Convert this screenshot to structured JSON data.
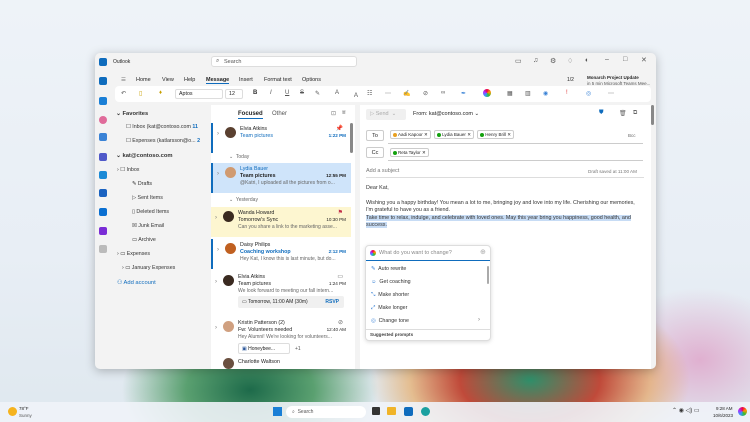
{
  "window": {
    "app_title": "Outlook",
    "search_placeholder": "Search"
  },
  "menu_tabs": [
    "Home",
    "View",
    "Help",
    "Message",
    "Insert",
    "Format text",
    "Options"
  ],
  "active_tab": "Message",
  "ribbon": {
    "font": "Aptos",
    "size": "12",
    "bold": "B",
    "italic": "I",
    "underline": "U",
    "strike": "S"
  },
  "notification": {
    "counter": "1/2",
    "title": "Monarch Project Update",
    "subtitle": "in 5 min Microsoft Teams Mee..."
  },
  "folders": {
    "favorites_label": "Favorites",
    "favorites": [
      {
        "label": "Inbox (kat@contoso.com",
        "count": "11"
      },
      {
        "label": "Expenses (katlarsson@o...",
        "count": "2"
      }
    ],
    "account": "kat@contoso.com",
    "items": [
      "Inbox",
      "Drafts",
      "Sent Items",
      "Deleted Items",
      "Junk Email",
      "Archive",
      "Expenses",
      "January Expenses"
    ],
    "add_account": "Add account"
  },
  "list": {
    "tabs": [
      "Focused",
      "Other"
    ],
    "groups": [
      "Today",
      "Yesterday"
    ],
    "mails": [
      {
        "name": "Elvia Atkins",
        "subject": "Team pictures",
        "preview": "",
        "time": "1:22 PM"
      },
      {
        "name": "Lydia Bauer",
        "subject": "Team pictures",
        "preview": "@Katri, I uploaded all the pictures from o...",
        "time": "12:55 PM"
      },
      {
        "name": "Wanda Howard",
        "subject": "Tomorrow's Sync",
        "preview": "Can you share a link to the marketing asse...",
        "time": "10:30 PM"
      },
      {
        "name": "Daisy Philips",
        "subject": "Coaching workshop",
        "preview": "Hey Kat, I know this is last minute, but do...",
        "time": "2:12 PM"
      },
      {
        "name": "Elvia Atkins",
        "subject": "Team pictures",
        "preview": "We look forward to meeting our fall intern...",
        "time": "1:24 PM"
      },
      {
        "name": "Kristin Patterson (2)",
        "subject": "Fw: Volunteers needed",
        "preview": "Hey Alumni! We're looking for volunteers...",
        "time": "12:40 AM"
      },
      {
        "name": "Charlotte Waltson",
        "subject": "",
        "preview": "",
        "time": ""
      }
    ],
    "event": {
      "when": "Tomorrow, 11:00 AM (30m)",
      "rsvp": "RSVP"
    },
    "attachment": {
      "name": "Honeybee...",
      "more": "+1"
    }
  },
  "compose": {
    "send": "Send",
    "from": "From: kat@contoso.com",
    "to_label": "To",
    "cc_label": "Cc",
    "bcc": "Bcc",
    "to": [
      "Aadi Kapoor",
      "Lydia Bauer",
      "Henry Brill"
    ],
    "cc": [
      "Reta Taylor"
    ],
    "subject_placeholder": "Add a subject",
    "draft_status": "Draft saved at 11:00 AM",
    "greeting": "Dear Kat,",
    "para1": "Wishing you a happy birthday! You mean a lot to me, bringing joy and love into my life. Cherishing our memories, I'm grateful to have you as a friend.",
    "para2": "Take time to relax, indulge, and celebrate with loved ones. May this year bring you happiness, good health, and success."
  },
  "copilot": {
    "placeholder": "What do you want to change?",
    "items": [
      "Auto rewrite",
      "Get coaching",
      "Make shorter",
      "Make longer",
      "Change tone"
    ],
    "suggested": "Suggested prompts"
  },
  "taskbar": {
    "temp": "78°F",
    "weather": "Sunny",
    "search": "Search",
    "time": "9:28 AM",
    "date": "10/6/2023"
  },
  "colors": {
    "accent": "#0f6cbd",
    "selected": "#cfe4fa",
    "flagged": "#fdf6d0",
    "highlight": "#c7dcf5"
  }
}
